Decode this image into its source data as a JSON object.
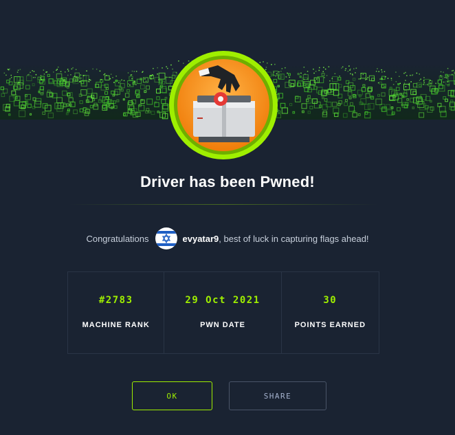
{
  "dialog": {
    "title": "Driver has been Pwned!",
    "congrats_prefix": "Congratulations",
    "username": "evyatar9",
    "congrats_suffix": ", best of luck in capturing flags ahead!"
  },
  "stats": [
    {
      "value": "#2783",
      "label": "MACHINE RANK"
    },
    {
      "value": "29 Oct 2021",
      "label": "PWN DATE"
    },
    {
      "value": "30",
      "label": "POINTS EARNED"
    }
  ],
  "buttons": {
    "ok_label": "OK",
    "share_label": "SHARE"
  },
  "icons": {
    "badge": "machine-badge-printer-icon",
    "avatar": "israel-flag-avatar"
  },
  "colors": {
    "background": "#1a2332",
    "accent": "#9fef00",
    "panel_border": "#2a3546",
    "badge_ring": "#9fef00",
    "badge_fill": "#f7941d"
  }
}
